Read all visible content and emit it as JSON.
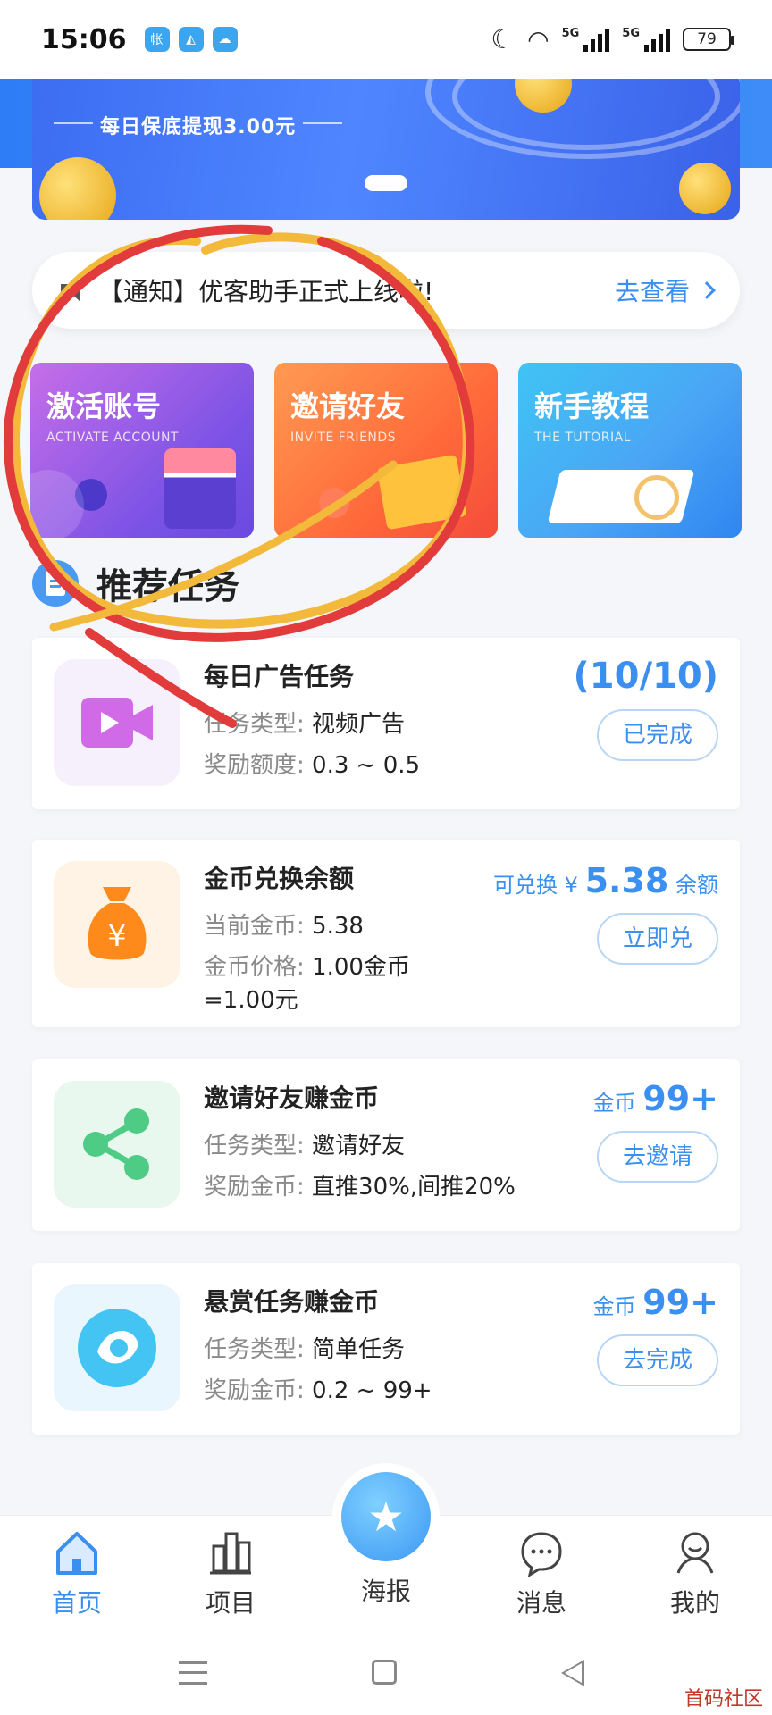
{
  "status_bar": {
    "time": "15:06",
    "app_badges": [
      "帐",
      "◭",
      "☁"
    ],
    "signal_1": "5G",
    "signal_2": "5G",
    "battery": "79"
  },
  "banner": {
    "text": "每日保底提现3.00元"
  },
  "notice": {
    "text": "【通知】优客助手正式上线啦!",
    "link": "去查看"
  },
  "features": [
    {
      "title": "激活账号",
      "subtitle": "ACTIVATE ACCOUNT"
    },
    {
      "title": "邀请好友",
      "subtitle": "INVITE FRIENDS"
    },
    {
      "title": "新手教程",
      "subtitle": "THE TUTORIAL"
    }
  ],
  "section_title": "推荐任务",
  "tasks": [
    {
      "title": "每日广告任务",
      "row1_key": "任务类型:",
      "row1_val": "视频广告",
      "row2_key": "奖励额度:",
      "row2_val": "0.3 ~ 0.5",
      "badge": "(10/10)",
      "button": "已完成"
    },
    {
      "title": "金币兑换余额",
      "row1_key": "当前金币:",
      "row1_val": "5.38",
      "row2_key": "金币价格:",
      "row2_val": "1.00金币",
      "row2_extra": "=1.00元",
      "prefix": "可兑换 ¥",
      "amount": "5.38",
      "suffix": "余额",
      "button": "立即兑"
    },
    {
      "title": "邀请好友赚金币",
      "row1_key": "任务类型:",
      "row1_val": "邀请好友",
      "row2_key": "奖励金币:",
      "row2_val": "直推30%,间推20%",
      "prefix": "金币",
      "amount": "99+",
      "button": "去邀请"
    },
    {
      "title": "悬赏任务赚金币",
      "row1_key": "任务类型:",
      "row1_val": "简单任务",
      "row2_key": "奖励金币:",
      "row2_val": "0.2 ~ 99+",
      "prefix": "金币",
      "amount": "99+",
      "button": "去完成"
    }
  ],
  "tabs": [
    {
      "label": "首页"
    },
    {
      "label": "项目"
    },
    {
      "label": "海报"
    },
    {
      "label": "消息"
    },
    {
      "label": "我的"
    }
  ],
  "watermark": "首码社区",
  "colors": {
    "accent": "#3b8ff0",
    "annotation_red": "#e23b3b",
    "annotation_yellow": "#f2b93a"
  }
}
